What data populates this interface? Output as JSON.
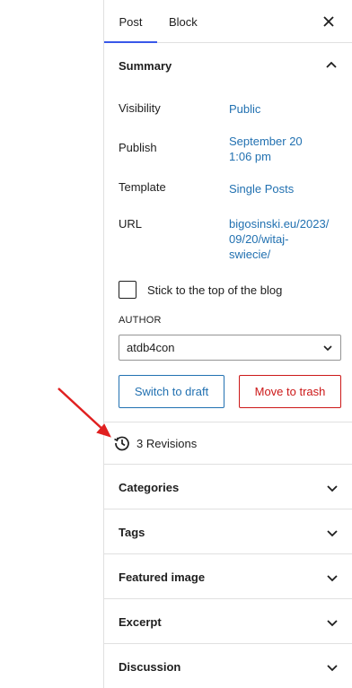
{
  "tabs": {
    "post": "Post",
    "block": "Block"
  },
  "summary": {
    "title": "Summary",
    "visibility_label": "Visibility",
    "visibility_value": "Public",
    "publish_label": "Publish",
    "publish_line1": "September 20",
    "publish_line2": "1:06 pm",
    "template_label": "Template",
    "template_value": "Single Posts",
    "url_label": "URL",
    "url_line1": "bigosinski.eu/2023/",
    "url_line2": "09/20/witaj-",
    "url_line3": "swiecie/",
    "sticky_label": "Stick to the top of the blog",
    "author_label": "AUTHOR",
    "author_value": "atdb4con",
    "switch_draft": "Switch to draft",
    "move_trash": "Move to trash"
  },
  "revisions": {
    "label": "3 Revisions"
  },
  "sections": [
    "Categories",
    "Tags",
    "Featured image",
    "Excerpt",
    "Discussion"
  ],
  "colors": {
    "accent": "#3858e9",
    "link": "#2271b1",
    "danger": "#cc1818",
    "annotation_arrow": "#e02020"
  }
}
